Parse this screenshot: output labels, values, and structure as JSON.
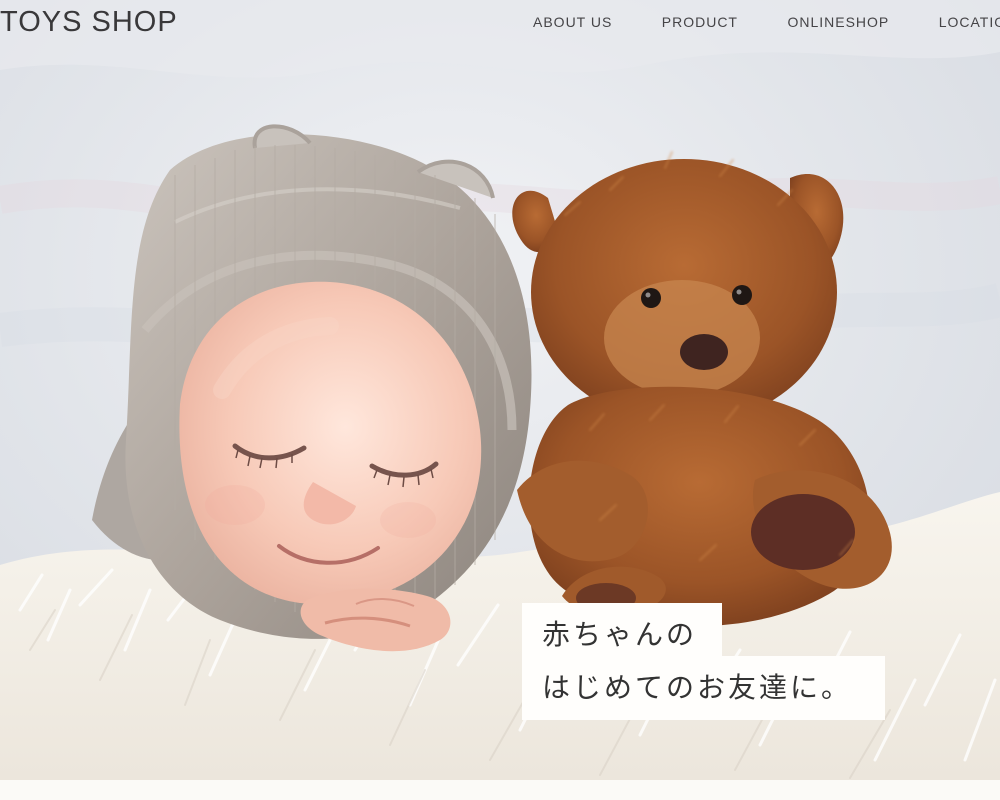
{
  "header": {
    "brand": "TOYS SHOP"
  },
  "nav": {
    "items": [
      "ABOUT US",
      "PRODUCT",
      "ONLINESHOP",
      "LOCATION"
    ]
  },
  "hero": {
    "line1": "赤ちゃんの",
    "line2": "はじめてのお友達に。"
  },
  "colors": {
    "text": "#39383a",
    "copy_background": "#fffefc",
    "page_background": "#fbfaf7"
  }
}
